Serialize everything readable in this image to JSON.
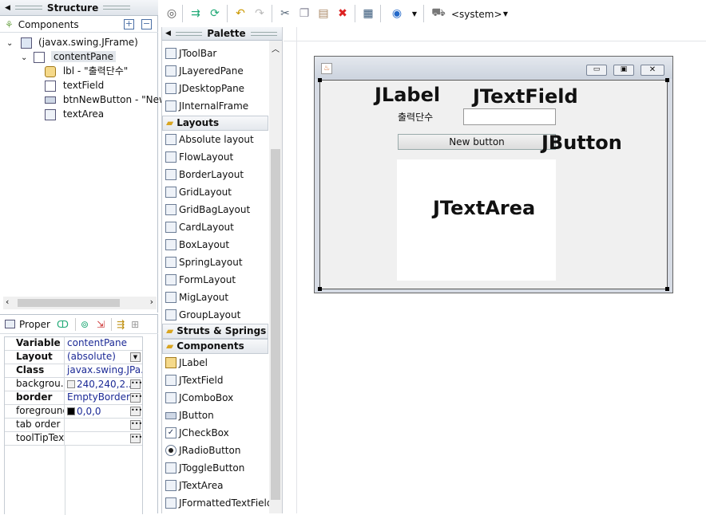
{
  "structure": {
    "title": "Structure",
    "components_label": "Components",
    "tree": [
      {
        "label": "(javax.swing.JFrame)",
        "icon": "jframe-icon"
      },
      {
        "label": "contentPane",
        "icon": "panel-icon"
      },
      {
        "label": "lbl - \"출력단수\"",
        "icon": "label-icon"
      },
      {
        "label": "textField",
        "icon": "textfield-icon"
      },
      {
        "label": "btnNewButton - \"New",
        "icon": "button-icon"
      },
      {
        "label": "textArea",
        "icon": "textarea-icon"
      }
    ]
  },
  "properties": {
    "title": "Proper",
    "rows": [
      {
        "key": "Variable",
        "value": "contentPane",
        "bold": true
      },
      {
        "key": "Layout",
        "value": "(absolute)",
        "bold": true
      },
      {
        "key": "Class",
        "value": "javax.swing.JPa...",
        "bold": true
      },
      {
        "key": "backgrou...",
        "value": "240,240,2...",
        "bold": false
      },
      {
        "key": "border",
        "value": "EmptyBorder",
        "bold": true
      },
      {
        "key": "foreground",
        "value": "0,0,0",
        "bold": false
      },
      {
        "key": "tab order",
        "value": "",
        "bold": false
      },
      {
        "key": "toolTipText",
        "value": "",
        "bold": false
      }
    ]
  },
  "toolbar": {
    "system_label": "<system>"
  },
  "palette": {
    "title": "Palette",
    "items_top": [
      "JToolBar",
      "JLayeredPane",
      "JDesktopPane",
      "JInternalFrame"
    ],
    "layouts_label": "Layouts",
    "layouts": [
      "Absolute layout",
      "FlowLayout",
      "BorderLayout",
      "GridLayout",
      "GridBagLayout",
      "CardLayout",
      "BoxLayout",
      "SpringLayout",
      "FormLayout",
      "MigLayout",
      "GroupLayout"
    ],
    "struts_label": "Struts & Springs",
    "components_label": "Components",
    "components": [
      "JLabel",
      "JTextField",
      "JComboBox",
      "JButton",
      "JCheckBox",
      "JRadioButton",
      "JToggleButton",
      "JTextArea",
      "JFormattedTextField"
    ]
  },
  "design": {
    "label_text": "출력단수",
    "button_text": "New button",
    "annotations": {
      "jlabel": "JLabel",
      "jtextfield": "JTextField",
      "jbutton": "JButton",
      "jtextarea": "JTextArea"
    }
  }
}
